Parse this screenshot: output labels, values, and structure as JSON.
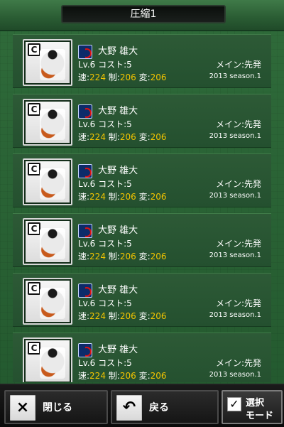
{
  "header": {
    "title": "圧縮1"
  },
  "cards": [
    {
      "name": "大野 雄大",
      "level_cost": "Lv.6 コスト:5",
      "position": "メイン:先発",
      "season": "2013 season.1",
      "stats": {
        "speed": "224",
        "control": "206",
        "movement": "206"
      }
    },
    {
      "name": "大野 雄大",
      "level_cost": "Lv.6 コスト:5",
      "position": "メイン:先発",
      "season": "2013 season.1",
      "stats": {
        "speed": "224",
        "control": "206",
        "movement": "206"
      }
    },
    {
      "name": "大野 雄大",
      "level_cost": "Lv.6 コスト:5",
      "position": "メイン:先発",
      "season": "2013 season.1",
      "stats": {
        "speed": "224",
        "control": "206",
        "movement": "206"
      }
    },
    {
      "name": "大野 雄大",
      "level_cost": "Lv.6 コスト:5",
      "position": "メイン:先発",
      "season": "2013 season.1",
      "stats": {
        "speed": "224",
        "control": "206",
        "movement": "206"
      }
    },
    {
      "name": "大野 雄大",
      "level_cost": "Lv.6 コスト:5",
      "position": "メイン:先発",
      "season": "2013 season.1",
      "stats": {
        "speed": "224",
        "control": "206",
        "movement": "206"
      }
    },
    {
      "name": "大野 雄大",
      "level_cost": "Lv.6 コスト:5",
      "position": "メイン:先発",
      "season": "2013 season.1",
      "stats": {
        "speed": "224",
        "control": "206",
        "movement": "206"
      }
    }
  ],
  "stat_labels": {
    "speed": "速:",
    "control": "制:",
    "movement": "変:"
  },
  "buttons": {
    "close": {
      "icon": "close-icon",
      "label": "閉じる"
    },
    "back": {
      "icon": "undo-icon",
      "label": "戻る"
    },
    "mode": {
      "icon": "checkbox-icon",
      "line1": "選択",
      "line2": "モード"
    }
  }
}
